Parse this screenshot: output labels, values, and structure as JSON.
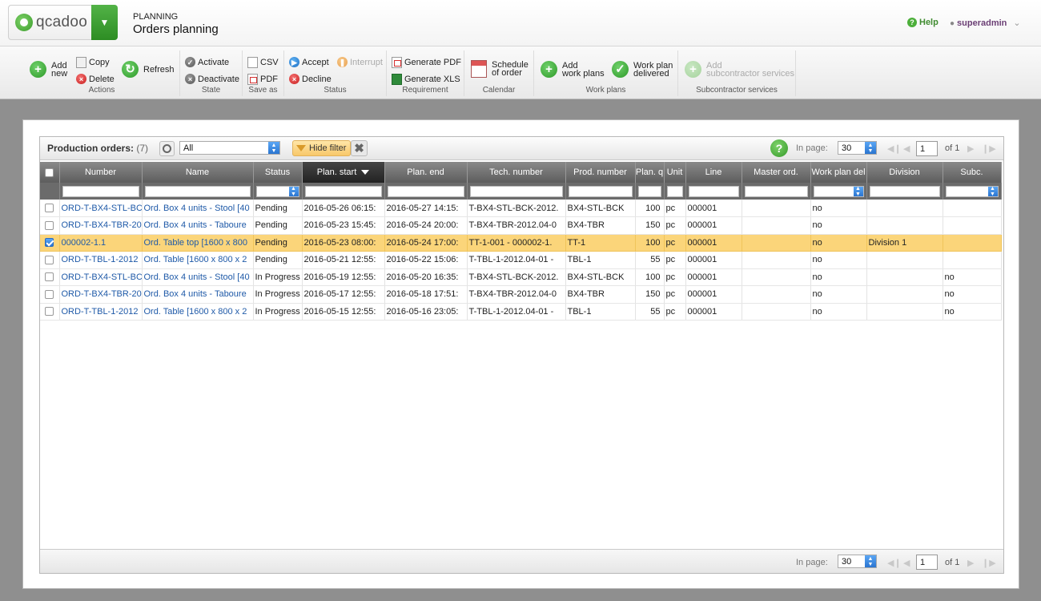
{
  "header": {
    "logo_text": "qcadoo",
    "section": "PLANNING",
    "title": "Orders planning",
    "help": "Help",
    "user": "superadmin"
  },
  "ribbon": {
    "actions": {
      "label": "Actions",
      "add": "Add",
      "add2": "new",
      "copy": "Copy",
      "delete": "Delete",
      "refresh": "Refresh"
    },
    "state": {
      "label": "State",
      "activate": "Activate",
      "deactivate": "Deactivate"
    },
    "save_as": {
      "label": "Save as",
      "csv": "CSV",
      "pdf": "PDF"
    },
    "status": {
      "label": "Status",
      "accept": "Accept",
      "interrupt": "Interrupt",
      "decline": "Decline"
    },
    "requirement": {
      "label": "Requirement",
      "gen_pdf": "Generate PDF",
      "gen_xls": "Generate XLS"
    },
    "calendar": {
      "label": "Calendar",
      "schedule1": "Schedule",
      "schedule2": "of order"
    },
    "work_plans": {
      "label": "Work plans",
      "add1": "Add",
      "add2": "work plans",
      "delivered1": "Work plan",
      "delivered2": "delivered"
    },
    "subcontractor": {
      "label": "Subcontractor services",
      "add1": "Add",
      "add2": "subcontractor services"
    }
  },
  "grid": {
    "title": "Production orders:",
    "count": "(7)",
    "filter_select": "All",
    "hide_filter": "Hide filter",
    "in_page_label": "In page:",
    "in_page_value": "30",
    "page": "1",
    "of": "of 1",
    "columns": [
      "Number",
      "Name",
      "Status",
      "Plan. start",
      "Plan. end",
      "Tech. number",
      "Prod. number",
      "Plan. q",
      "Unit",
      "Line",
      "Master ord.",
      "Work plan del",
      "Division",
      "Subc."
    ],
    "rows": [
      [
        "ORD-T-BX4-STL-BC",
        "Ord. Box 4 units - Stool [40",
        "Pending",
        "2016-05-26 06:15:",
        "2016-05-27 14:15:",
        "T-BX4-STL-BCK-2012.",
        "BX4-STL-BCK",
        "100",
        "pc",
        "000001",
        "",
        "no",
        "",
        ""
      ],
      [
        "ORD-T-BX4-TBR-20",
        "Ord. Box 4 units - Taboure",
        "Pending",
        "2016-05-23 15:45:",
        "2016-05-24 20:00:",
        "T-BX4-TBR-2012.04-0",
        "BX4-TBR",
        "150",
        "pc",
        "000001",
        "",
        "no",
        "",
        ""
      ],
      [
        "000002-1.1",
        "Ord. Table top [1600 x 800",
        "Pending",
        "2016-05-23 08:00:",
        "2016-05-24 17:00:",
        "TT-1-001 - 000002-1.",
        "TT-1",
        "100",
        "pc",
        "000001",
        "",
        "no",
        "Division 1",
        ""
      ],
      [
        "ORD-T-TBL-1-2012",
        "Ord. Table [1600 x 800 x 2",
        "Pending",
        "2016-05-21 12:55:",
        "2016-05-22 15:06:",
        "T-TBL-1-2012.04-01 -",
        "TBL-1",
        "55",
        "pc",
        "000001",
        "",
        "no",
        "",
        ""
      ],
      [
        "ORD-T-BX4-STL-BC",
        "Ord. Box 4 units - Stool [40",
        "In Progress",
        "2016-05-19 12:55:",
        "2016-05-20 16:35:",
        "T-BX4-STL-BCK-2012.",
        "BX4-STL-BCK",
        "100",
        "pc",
        "000001",
        "",
        "no",
        "",
        "no"
      ],
      [
        "ORD-T-BX4-TBR-20",
        "Ord. Box 4 units - Taboure",
        "In Progress",
        "2016-05-17 12:55:",
        "2016-05-18 17:51:",
        "T-BX4-TBR-2012.04-0",
        "BX4-TBR",
        "150",
        "pc",
        "000001",
        "",
        "no",
        "",
        "no"
      ],
      [
        "ORD-T-TBL-1-2012",
        "Ord. Table [1600 x 800 x 2",
        "In Progress",
        "2016-05-15 12:55:",
        "2016-05-16 23:05:",
        "T-TBL-1-2012.04-01 -",
        "TBL-1",
        "55",
        "pc",
        "000001",
        "",
        "no",
        "",
        "no"
      ]
    ],
    "selected_row": 2
  }
}
